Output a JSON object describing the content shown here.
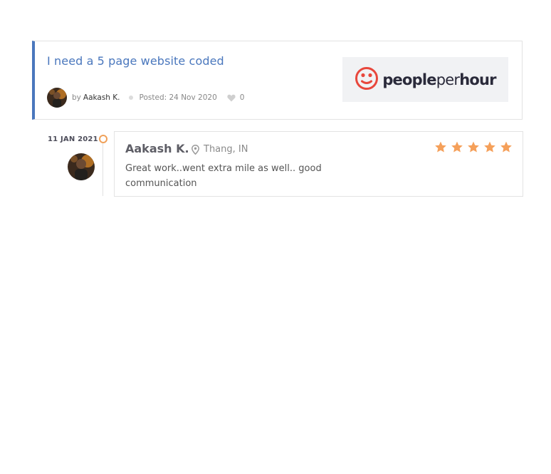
{
  "job": {
    "title": "I need a 5 page website coded",
    "by_label": "by",
    "author": "Aakash K.",
    "posted": "Posted: 24 Nov 2020",
    "likes": "0"
  },
  "logo": {
    "part1": "people",
    "part2": "per",
    "part3": "hour",
    "brand_color": "#e8473c"
  },
  "review": {
    "date": "11 JAN 2021",
    "reviewer": "Aakash K.",
    "location": "Thang, IN",
    "rating": 5,
    "text": "Great work..went extra mile as well.. good communication"
  },
  "colors": {
    "accent": "#4a77bd",
    "star": "#f5a05a",
    "timeline": "#f0a15a"
  },
  "icons": [
    "avatar",
    "heart-icon",
    "map-pin-icon",
    "star-icon",
    "peopleperhour-logo-icon"
  ]
}
